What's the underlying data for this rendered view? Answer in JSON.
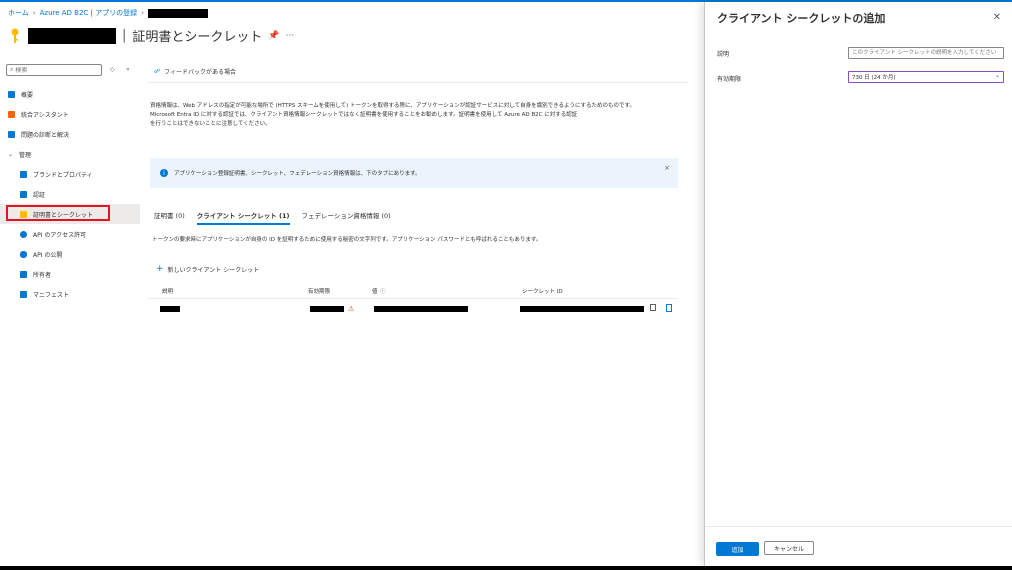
{
  "breadcrumb": {
    "home": "ホーム",
    "tenant": "Azure AD B2C | アプリの登録"
  },
  "page": {
    "title": "証明書とシークレット"
  },
  "sidebar": {
    "search_placeholder": "検索",
    "items": [
      {
        "label": "概要",
        "icon": "grid-icon",
        "color": "#0078d4"
      },
      {
        "label": "統合アシスタント",
        "icon": "rocket-icon",
        "color": "#f7630c"
      },
      {
        "label": "問題の診断と解決",
        "icon": "wrench-icon",
        "color": "#0078d4"
      },
      {
        "label": "管理",
        "icon": "chevron-down-icon",
        "color": "#605e5c"
      },
      {
        "label": "ブランドとプロパティ",
        "icon": "brand-icon",
        "color": "#0078d4"
      },
      {
        "label": "認証",
        "icon": "auth-icon",
        "color": "#0078d4"
      },
      {
        "label": "証明書とシークレット",
        "icon": "key-icon",
        "color": "#ffb900"
      },
      {
        "label": "API のアクセス許可",
        "icon": "api-icon",
        "color": "#0078d4"
      },
      {
        "label": "API の公開",
        "icon": "cloud-icon",
        "color": "#0078d4"
      },
      {
        "label": "所有者",
        "icon": "owners-icon",
        "color": "#0078d4"
      },
      {
        "label": "マニフェスト",
        "icon": "manifest-icon",
        "color": "#0078d4"
      }
    ]
  },
  "main": {
    "feedback_label": "フィードバックがある場合",
    "description_line1": "資格情報は、Web アドレスの指定が可能な場所で (HTTPS スキームを使用して) トークンを取得する際に、アプリケーションが認証サービスに対して自身を識別できるようにするためのものです。",
    "description_line2": "Microsoft Entra ID に対する認証では、クライアント資格情報シークレットではなく証明書を使用することをお勧めします。証明書を使用して Azure AD B2C に対する認証",
    "description_line3": "を行うことはできないことに注意してください。",
    "info_text": "アプリケーション登録証明書、シークレット、フェデレーション資格情報は、下のタブにあります。",
    "tabs": [
      {
        "label": "証明書 (0)"
      },
      {
        "label": "クライアント シークレット (1)"
      },
      {
        "label": "フェデレーション資格情報 (0)"
      }
    ],
    "tab_description": "トークンの要求時にアプリケーションが自身の ID を証明するために使用する秘密の文字列です。アプリケーション パスワードとも呼ばれることもあります。",
    "new_secret_label": "新しいクライアント シークレット",
    "table": {
      "columns": [
        "説明",
        "有効期限",
        "値",
        "シークレット ID"
      ]
    }
  },
  "panel": {
    "title": "クライアント シークレットの追加",
    "description_label": "説明",
    "description_placeholder": "このクライアント シークレットの説明を入力してください",
    "expiry_label": "有効期限",
    "expiry_value": "730 日 (24 か月)",
    "add_label": "追加",
    "cancel_label": "キャンセル"
  },
  "colors": {
    "accent": "#0078d4",
    "highlight": "#e81123",
    "info_bg": "#ebf3fc"
  }
}
